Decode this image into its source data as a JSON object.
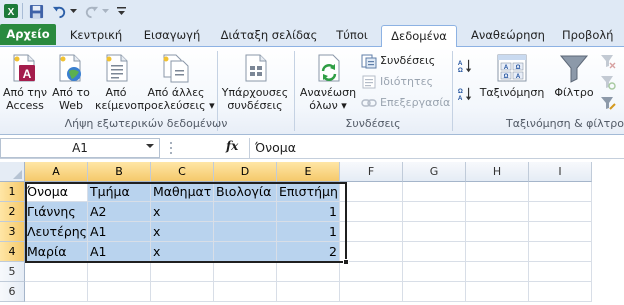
{
  "quick_access": {
    "icons": [
      "excel-icon",
      "save-icon",
      "undo-icon",
      "redo-icon",
      "customize-icon"
    ]
  },
  "tabs": [
    {
      "label": "Αρχείο",
      "active": false
    },
    {
      "label": "Κεντρική",
      "active": false
    },
    {
      "label": "Εισαγωγή",
      "active": false
    },
    {
      "label": "Διάταξη σελίδας",
      "active": false
    },
    {
      "label": "Τύποι",
      "active": false
    },
    {
      "label": "Δεδομένα",
      "active": true
    },
    {
      "label": "Αναθεώρηση",
      "active": false
    },
    {
      "label": "Προβολή",
      "active": false
    }
  ],
  "ribbon": {
    "external_data": {
      "from_access": {
        "line1": "Από την",
        "line2": "Access"
      },
      "from_web": {
        "line1": "Από το",
        "line2": "Web"
      },
      "from_text": {
        "line1": "Από",
        "line2": "κείμενο"
      },
      "from_other": {
        "line1": "Από άλλες",
        "line2": "προελεύσεις ▾"
      },
      "existing": {
        "line1": "Υπάρχουσες",
        "line2": "συνδέσεις"
      },
      "group_label": "Λήψη εξωτερικών δεδομένων"
    },
    "connections": {
      "refresh": {
        "line1": "Ανανέωση",
        "line2": "όλων ▾"
      },
      "connections_label": "Συνδέσεις",
      "properties_label": "Ιδιότητες",
      "edit_links_label": "Επεξεργασία",
      "group_label": "Συνδέσεις"
    },
    "sort_filter": {
      "sort_label": "Ταξινόμηση",
      "filter_label": "Φίλτρο",
      "group_label": "Ταξινόμηση & φίλτρο"
    }
  },
  "formula_bar": {
    "name_box": "A1",
    "fx_label": "fx",
    "value": "Όνομα"
  },
  "grid": {
    "columns": [
      "A",
      "B",
      "C",
      "D",
      "E",
      "F",
      "G",
      "H",
      "I"
    ],
    "row_numbers": [
      "1",
      "2",
      "3",
      "4",
      "5",
      "6"
    ],
    "rows": [
      [
        "Όνομα",
        "Τμήμα",
        "Μαθηματ",
        "Βιολογία",
        "Επιστήμη"
      ],
      [
        "Γιάννης",
        "Α2",
        "x",
        "",
        "1"
      ],
      [
        "Λευτέρης",
        "Α1",
        "x",
        "",
        "1"
      ],
      [
        "Μαρία",
        "Α1",
        "x",
        "",
        "2"
      ]
    ]
  },
  "colors": {
    "file_tab": "#2a8a3e",
    "selection_fill": "#b9d3ee",
    "header_selected": "#f5c96b"
  }
}
